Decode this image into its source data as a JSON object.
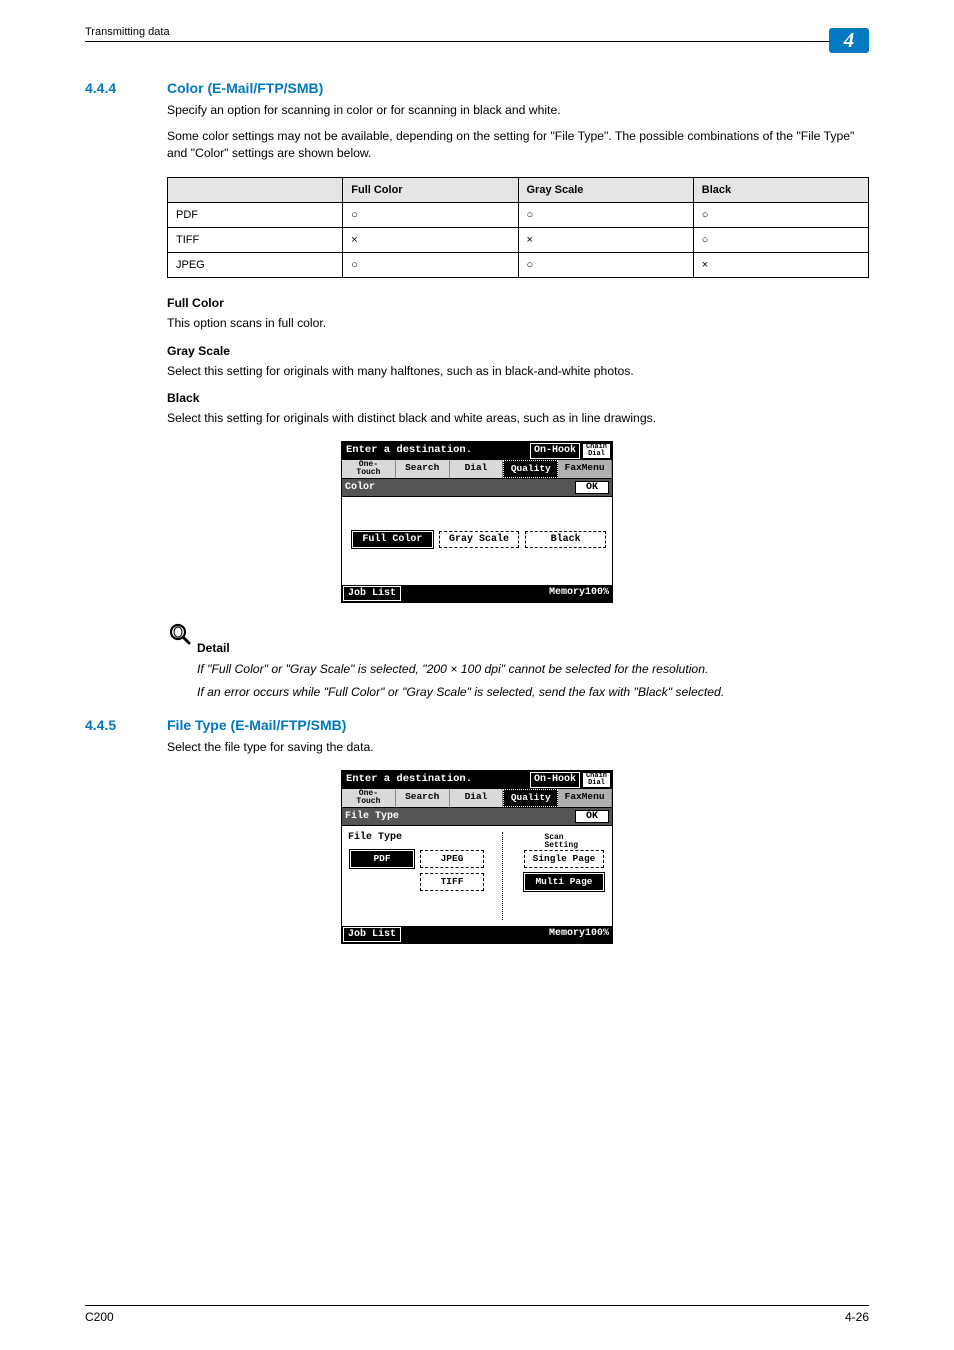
{
  "header": {
    "running": "Transmitting data",
    "chapter": "4"
  },
  "sections": [
    {
      "num": "4.4.4",
      "title": "Color (E-Mail/FTP/SMB)",
      "paras": [
        "Specify an option for scanning in color or for scanning in black and white.",
        "Some color settings may not be available, depending on the setting for \"File Type\". The possible combinations of the \"File Type\" and \"Color\" settings are shown below."
      ],
      "table": {
        "cols": [
          "",
          "Full Color",
          "Gray Scale",
          "Black"
        ],
        "rows": [
          [
            "PDF",
            "○",
            "○",
            "○"
          ],
          [
            "TIFF",
            "×",
            "×",
            "○"
          ],
          [
            "JPEG",
            "○",
            "○",
            "×"
          ]
        ]
      },
      "subs": [
        {
          "h": "Full Color",
          "t": "This option scans in full color."
        },
        {
          "h": "Gray Scale",
          "t": "Select this setting for originals with many halftones, such as in black-and-white photos."
        },
        {
          "h": "Black",
          "t": "Select this setting for originals with distinct black and white areas, such as in line drawings."
        }
      ],
      "screen": {
        "title": "Enter a destination.",
        "onhook": "On-Hook",
        "chain": {
          "l1": "Chain",
          "l2": "Dial"
        },
        "tabs": {
          "onetouch": {
            "l1": "One-",
            "l2": "Touch"
          },
          "search": "Search",
          "dial": "Dial",
          "quality": "Quality",
          "fax": "FaxMenu"
        },
        "sublabel": "Color",
        "ok": "OK",
        "opts": [
          "Full Color",
          "Gray Scale",
          "Black"
        ],
        "job": "Job List",
        "mem": "Memory100%"
      },
      "detail": {
        "label": "Detail",
        "lines": [
          "If \"Full Color\" or \"Gray Scale\" is selected, \"200 × 100 dpi\" cannot be selected for the resolution.",
          "If an error occurs while \"Full Color\" or \"Gray Scale\" is selected, send the fax with \"Black\" selected."
        ]
      }
    },
    {
      "num": "4.4.5",
      "title": "File Type (E-Mail/FTP/SMB)",
      "paras": [
        "Select the file type for saving the data."
      ],
      "screen2": {
        "title": "Enter a destination.",
        "onhook": "On-Hook",
        "chain": {
          "l1": "Chain",
          "l2": "Dial"
        },
        "tabs": {
          "onetouch": {
            "l1": "One-",
            "l2": "Touch"
          },
          "search": "Search",
          "dial": "Dial",
          "quality": "Quality",
          "fax": "FaxMenu"
        },
        "sublabel": "File Type",
        "ok": "OK",
        "leftlabel": "File Type",
        "rightlabel": {
          "l1": "Scan",
          "l2": "Setting"
        },
        "fileTypes": {
          "pdf": "PDF",
          "jpeg": "JPEG",
          "tiff": "TIFF"
        },
        "scanSettings": {
          "single": "Single Page",
          "multi": "Multi Page"
        },
        "job": "Job List",
        "mem": "Memory100%"
      }
    }
  ],
  "footer": {
    "model": "C200",
    "page": "4-26"
  }
}
